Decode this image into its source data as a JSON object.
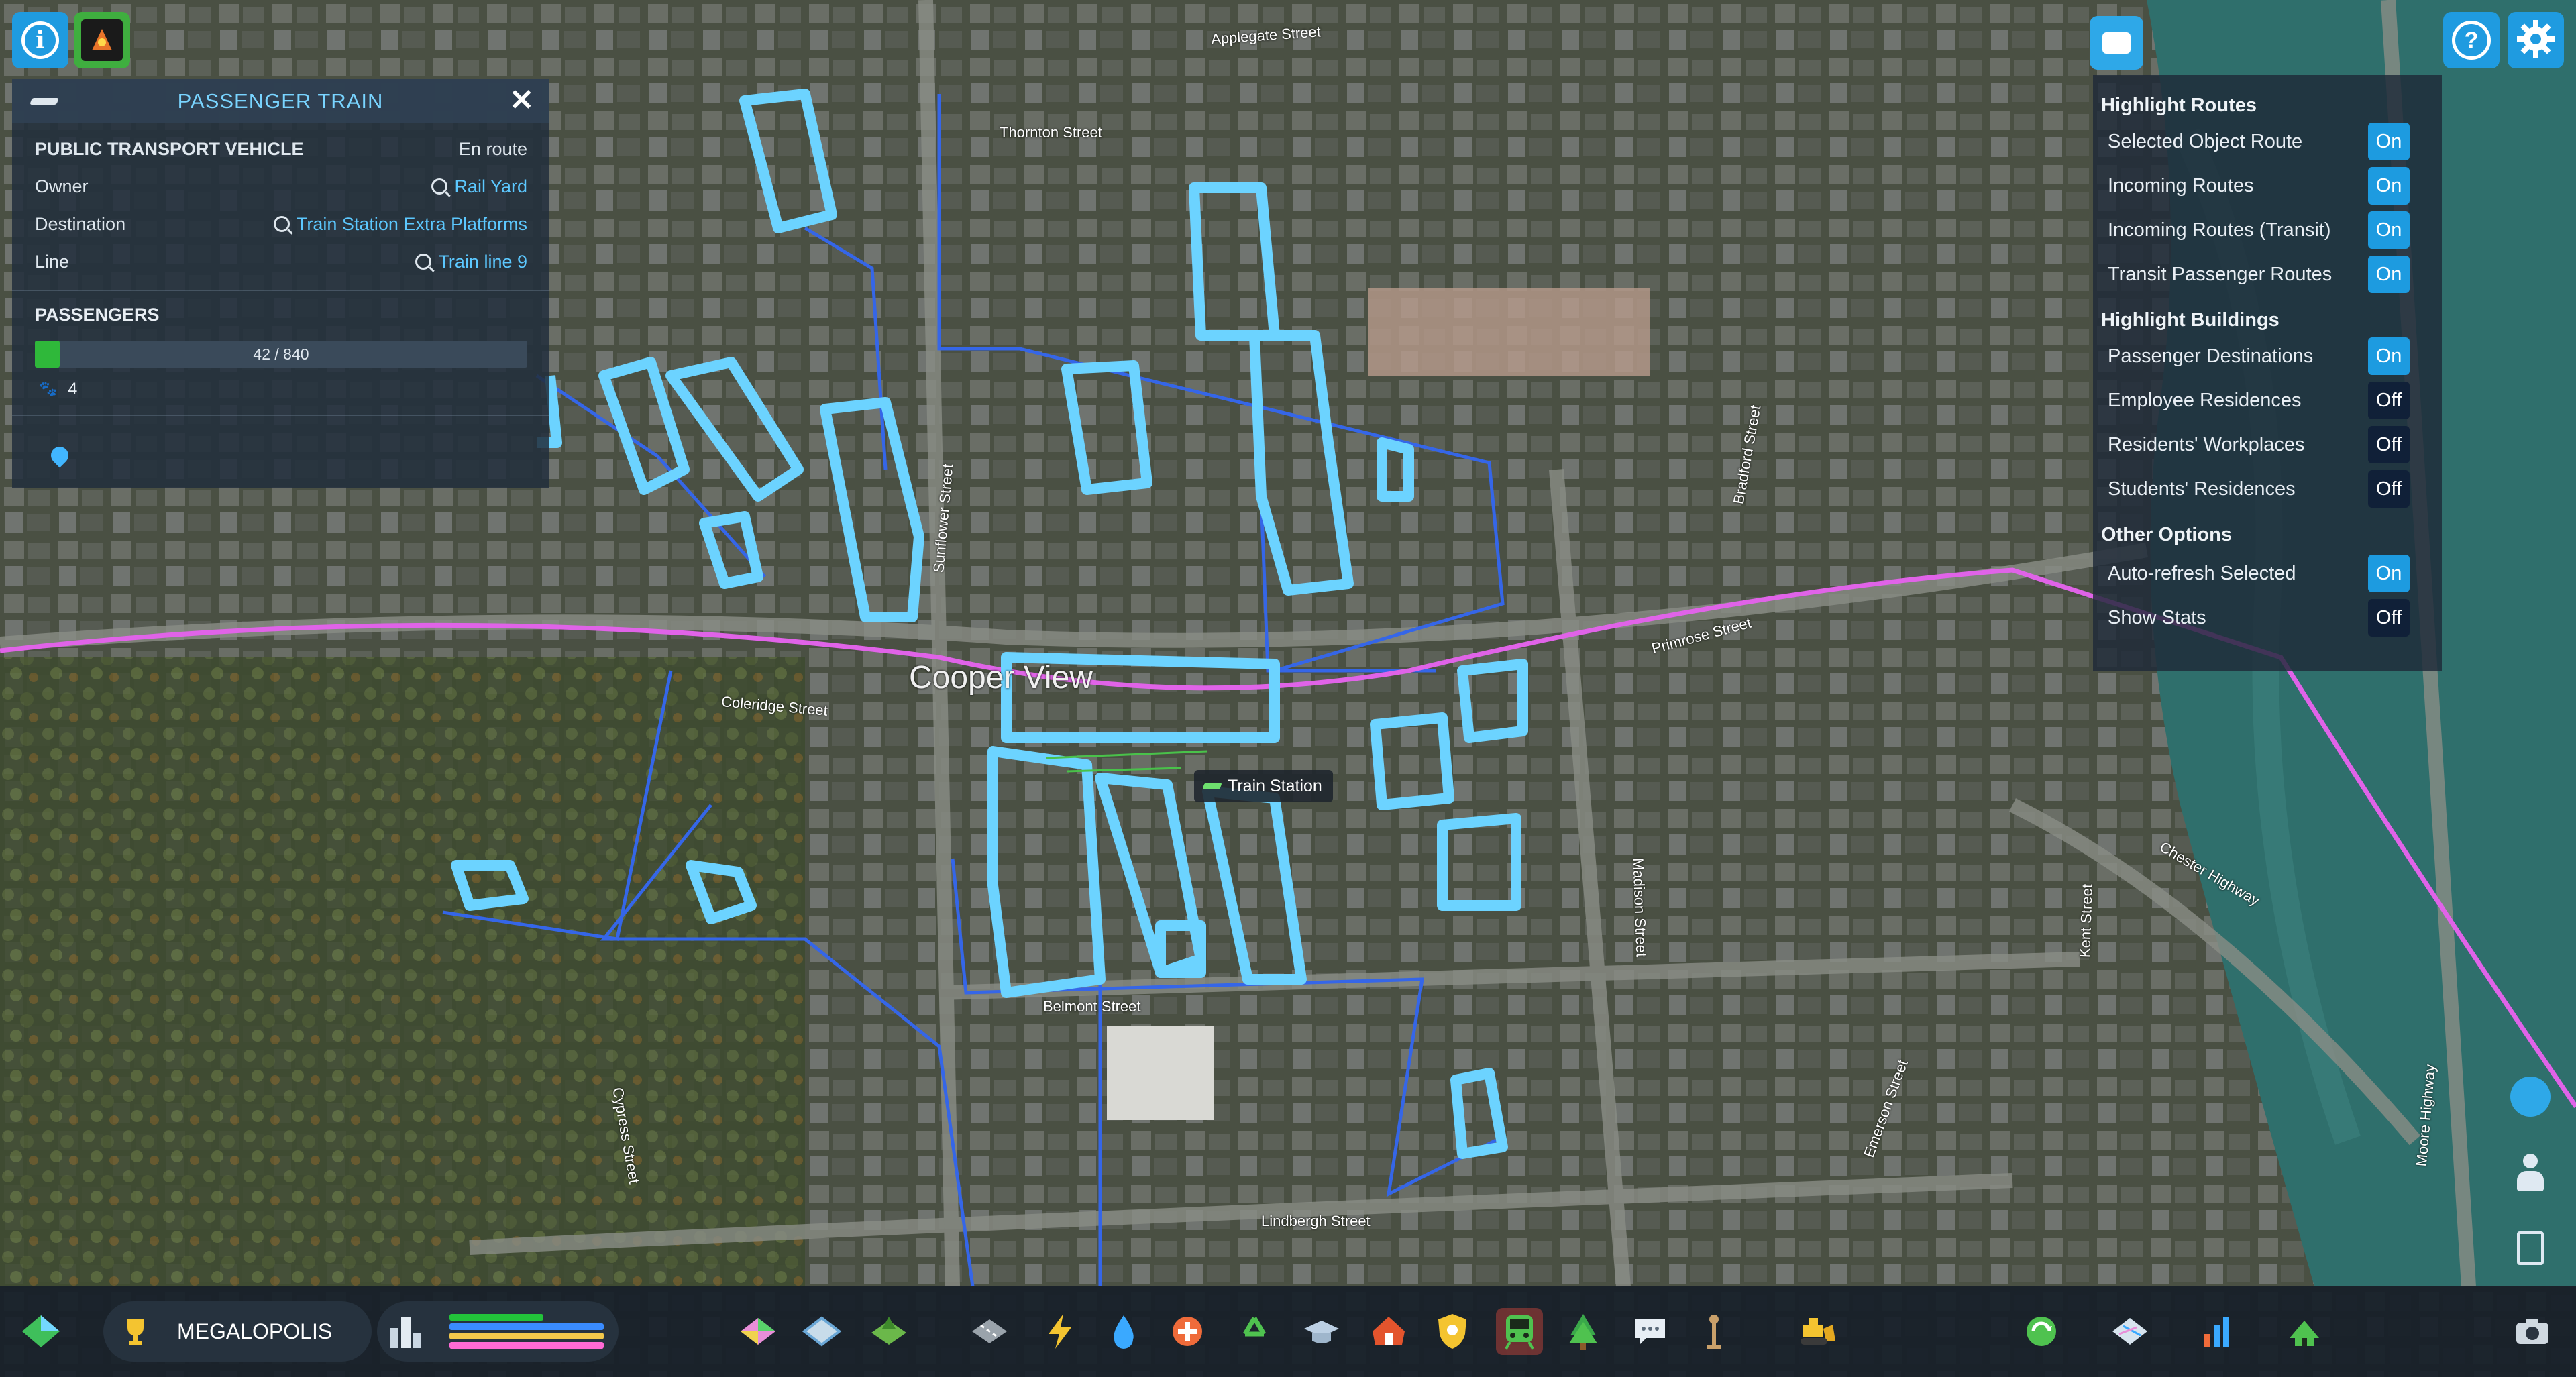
{
  "toolbar_top": {
    "info_icon": "info-icon",
    "advisor_icon": "chirper-avatar-icon",
    "help_icon": "help-icon",
    "settings_icon": "gear-icon",
    "chat_icon": "speech-bubble-icon"
  },
  "transport_panel": {
    "title": "PASSENGER TRAIN",
    "category": "PUBLIC TRANSPORT VEHICLE",
    "status": "En route",
    "owner_label": "Owner",
    "owner_value": "Rail Yard",
    "destination_label": "Destination",
    "destination_value": "Train Station Extra Platforms",
    "line_label": "Line",
    "line_value": "Train line 9",
    "passengers_title": "PASSENGERS",
    "passengers_text": "42 / 840",
    "passengers_fraction": 0.05,
    "pets_count": "4"
  },
  "route_panel": {
    "sections": [
      {
        "heading": "Highlight Routes",
        "rows": [
          {
            "label": "Selected Object Route",
            "state": "On"
          },
          {
            "label": "Incoming Routes",
            "state": "On"
          },
          {
            "label": "Incoming Routes (Transit)",
            "state": "On"
          },
          {
            "label": "Transit Passenger Routes",
            "state": "On"
          }
        ]
      },
      {
        "heading": "Highlight Buildings",
        "rows": [
          {
            "label": "Passenger Destinations",
            "state": "On"
          },
          {
            "label": "Employee Residences",
            "state": "Off"
          },
          {
            "label": "Residents' Workplaces",
            "state": "Off"
          },
          {
            "label": "Students' Residences",
            "state": "Off"
          }
        ]
      },
      {
        "heading": "Other Options",
        "rows": [
          {
            "label": "Auto-refresh Selected",
            "state": "On"
          },
          {
            "label": "Show Stats",
            "state": "Off"
          }
        ]
      }
    ]
  },
  "map": {
    "district_label": "Cooper View",
    "station_tooltip": "Train Station",
    "street_labels": [
      "Applegate Street",
      "Coleridge Street",
      "Belmont Street",
      "Lindbergh Street",
      "Madison Street",
      "Kent Street",
      "Chester Highway",
      "Primrose Street",
      "Moore Highway",
      "Cypress Street",
      "Sunflower Street",
      "Thornton Street",
      "Emerson Street",
      "Bradford Street"
    ]
  },
  "bottom_bar": {
    "city_name": "MEGALOPOLIS",
    "milestone_icon": "trophy-icon",
    "map_icon": "minimap-icon",
    "population_icon": "city-population-icon",
    "demand_colors": [
      "#22c33a",
      "#3a8cff",
      "#f2c84b",
      "#ff6ad5"
    ],
    "tools": [
      "zoning-icon",
      "area-icon",
      "landscaping-icon",
      "roads-icon",
      "electricity-icon",
      "water-icon",
      "healthcare-icon",
      "garbage-icon",
      "education-icon",
      "fire-icon",
      "police-icon",
      "transportation-icon",
      "parks-icon",
      "communication-icon",
      "landmark-icon",
      "bulldozer-icon"
    ],
    "right_tools": [
      "economy-icon",
      "map-tiles-icon",
      "statistics-icon",
      "city-services-icon"
    ],
    "camera_icon": "camera-icon"
  },
  "right_edge": [
    "chirper-icon",
    "citizen-icon",
    "journal-icon"
  ]
}
